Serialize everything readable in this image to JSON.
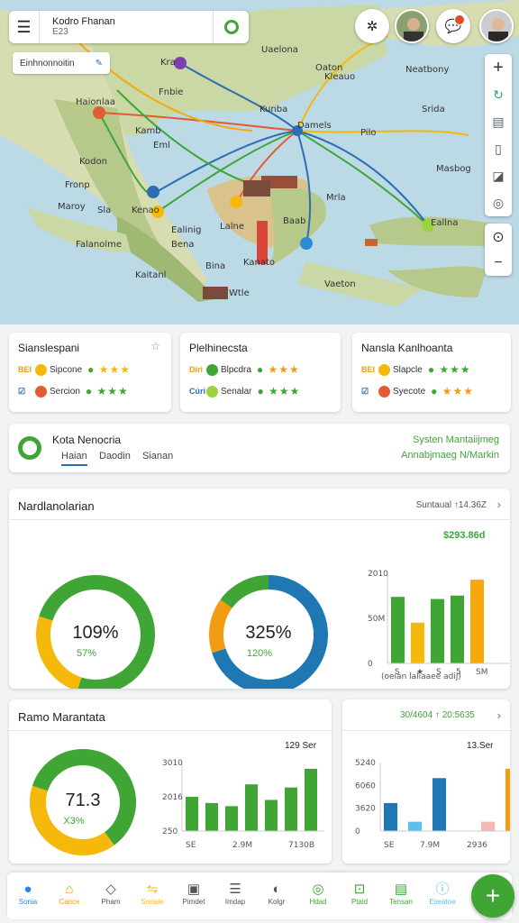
{
  "search": {
    "title": "Kodro Fhanan",
    "subtitle": "E23"
  },
  "filter": {
    "label": "Einhnonnoitin"
  },
  "map_labels": [
    "Kra",
    "Uaelona",
    "Oaton",
    "Kleauo",
    "Neatbony",
    "Haionlaa",
    "Fnbie",
    "Kunba",
    "Srida",
    "Kamb",
    "Eml",
    "Damels",
    "Pilo",
    "Masbog",
    "Kodon",
    "Fronp",
    "Maroy",
    "Sla",
    "Kenao",
    "Mrla",
    "Ealinig",
    "Lalne",
    "Eallna",
    "Falanolme",
    "Bena",
    "Baab",
    "Kanato",
    "Kaitanl",
    "Wtle",
    "Vaeton",
    "Bina"
  ],
  "place_cards": [
    {
      "title": "Sianslespani",
      "rows": [
        {
          "label": "BEI",
          "name": "Sipcone"
        },
        {
          "label": "☑",
          "name": "Sercion"
        }
      ]
    },
    {
      "title": "Plelhinecsta",
      "rows": [
        {
          "label": "Diri",
          "name": "Blpcdra"
        },
        {
          "label": "Cúri",
          "name": "Senalar"
        }
      ]
    },
    {
      "title": "Nansla Kanlhoanta",
      "rows": [
        {
          "label": "BEI",
          "name": "Slapcle"
        },
        {
          "label": "☑",
          "name": "Syecote"
        }
      ]
    }
  ],
  "summary": {
    "title": "Kota Nenocria",
    "tabs": [
      "Haian",
      "Daodin",
      "Sianan"
    ],
    "status_title": "Systen Mantaiijmeg",
    "status_sub": "Annabjmaeg N/Markin"
  },
  "section1": {
    "title": "Nardlanolarian",
    "summary": "Suntaual ↑14.36Z",
    "donut1": {
      "value": "109%",
      "sub": "57%"
    },
    "donut2": {
      "value": "325%",
      "sub": "120%"
    },
    "bar_top": "$293.86d",
    "x_caption": "(oeian laliaaee adij)",
    "x_ticks": [
      "S",
      "★",
      "S",
      "5",
      "SM"
    ]
  },
  "section2": {
    "title": "Ramo Marantata",
    "donut": {
      "value": "71.3",
      "sub": "X3%"
    },
    "bar_top": "129 Ser",
    "x_ticks": [
      "SE",
      "2.9M",
      "7130B"
    ]
  },
  "section3": {
    "summary": "30/4604 ↑ 20:5635",
    "bar_top": "13.Ser",
    "x_ticks": [
      "SE",
      "7.9M",
      "2936"
    ]
  },
  "nav": [
    {
      "icon": "location-icon",
      "label": "Sonia",
      "active": true
    },
    {
      "icon": "home-icon",
      "label": "Cance"
    },
    {
      "icon": "phone-icon",
      "label": "Pham"
    },
    {
      "icon": "route-icon",
      "label": "Srelale"
    },
    {
      "icon": "print-icon",
      "label": "Pimdet"
    },
    {
      "icon": "list-icon",
      "label": "Imdap"
    },
    {
      "icon": "settings-icon",
      "label": "Kolgr"
    },
    {
      "icon": "target-icon",
      "label": "Hdad"
    },
    {
      "icon": "map-icon",
      "label": "Ptaid"
    },
    {
      "icon": "save-icon",
      "label": "Tensan"
    },
    {
      "icon": "info-icon",
      "label": "Eseatoe"
    }
  ],
  "colors": {
    "green": "#3fa535",
    "orange": "#f39c12",
    "blue": "#1f77b4",
    "yellow": "#f5b90c"
  },
  "chart_data": [
    {
      "type": "pie",
      "title": "",
      "values": [
        55,
        25,
        20
      ],
      "center_label": "109%",
      "colors": [
        "#3fa535",
        "#f5b90c",
        "#3fa535"
      ]
    },
    {
      "type": "pie",
      "title": "",
      "values": [
        70,
        15,
        15
      ],
      "center_label": "325%",
      "colors": [
        "#1f77b4",
        "#f39c12",
        "#3fa535"
      ]
    },
    {
      "type": "bar",
      "title": "",
      "ylabel": "",
      "yticks": [
        "2010",
        "50M",
        "0"
      ],
      "categories": [
        "1",
        "2",
        "3",
        "4",
        "5",
        "6"
      ],
      "values": [
        155,
        95,
        150,
        158,
        195,
        0
      ],
      "colors": [
        "#3fa535",
        "#f5b90c",
        "#3fa535",
        "#3fa535",
        "#f5a90c",
        "#f5a90c"
      ],
      "ylim": [
        0,
        210
      ]
    },
    {
      "type": "pie",
      "title": "",
      "values": [
        40,
        40,
        20
      ],
      "center_label": "71.3",
      "colors": [
        "#3fa535",
        "#f5b90c",
        "#3fa535"
      ]
    },
    {
      "type": "bar",
      "title": "",
      "yticks": [
        "3010",
        "2016",
        "250"
      ],
      "categories": [
        "1",
        "2",
        "3",
        "4",
        "5",
        "6",
        "7"
      ],
      "values": [
        55,
        45,
        40,
        75,
        50,
        70,
        100
      ],
      "colors": [
        "#3fa535",
        "#3fa535",
        "#3fa535",
        "#3fa535",
        "#3fa535",
        "#3fa535",
        "#3fa535"
      ],
      "ylim": [
        0,
        110
      ]
    },
    {
      "type": "bar",
      "title": "",
      "yticks": [
        "5240",
        "6060",
        "3620",
        "0"
      ],
      "categories": [
        "1",
        "2",
        "3",
        "4",
        "5",
        "6"
      ],
      "values": [
        45,
        15,
        85,
        0,
        15,
        100
      ],
      "colors": [
        "#1f77b4",
        "#5bc0eb",
        "#1f77b4",
        "#1f77b4",
        "#f2b8b8",
        "#f39c12"
      ],
      "ylim": [
        0,
        110
      ]
    }
  ]
}
